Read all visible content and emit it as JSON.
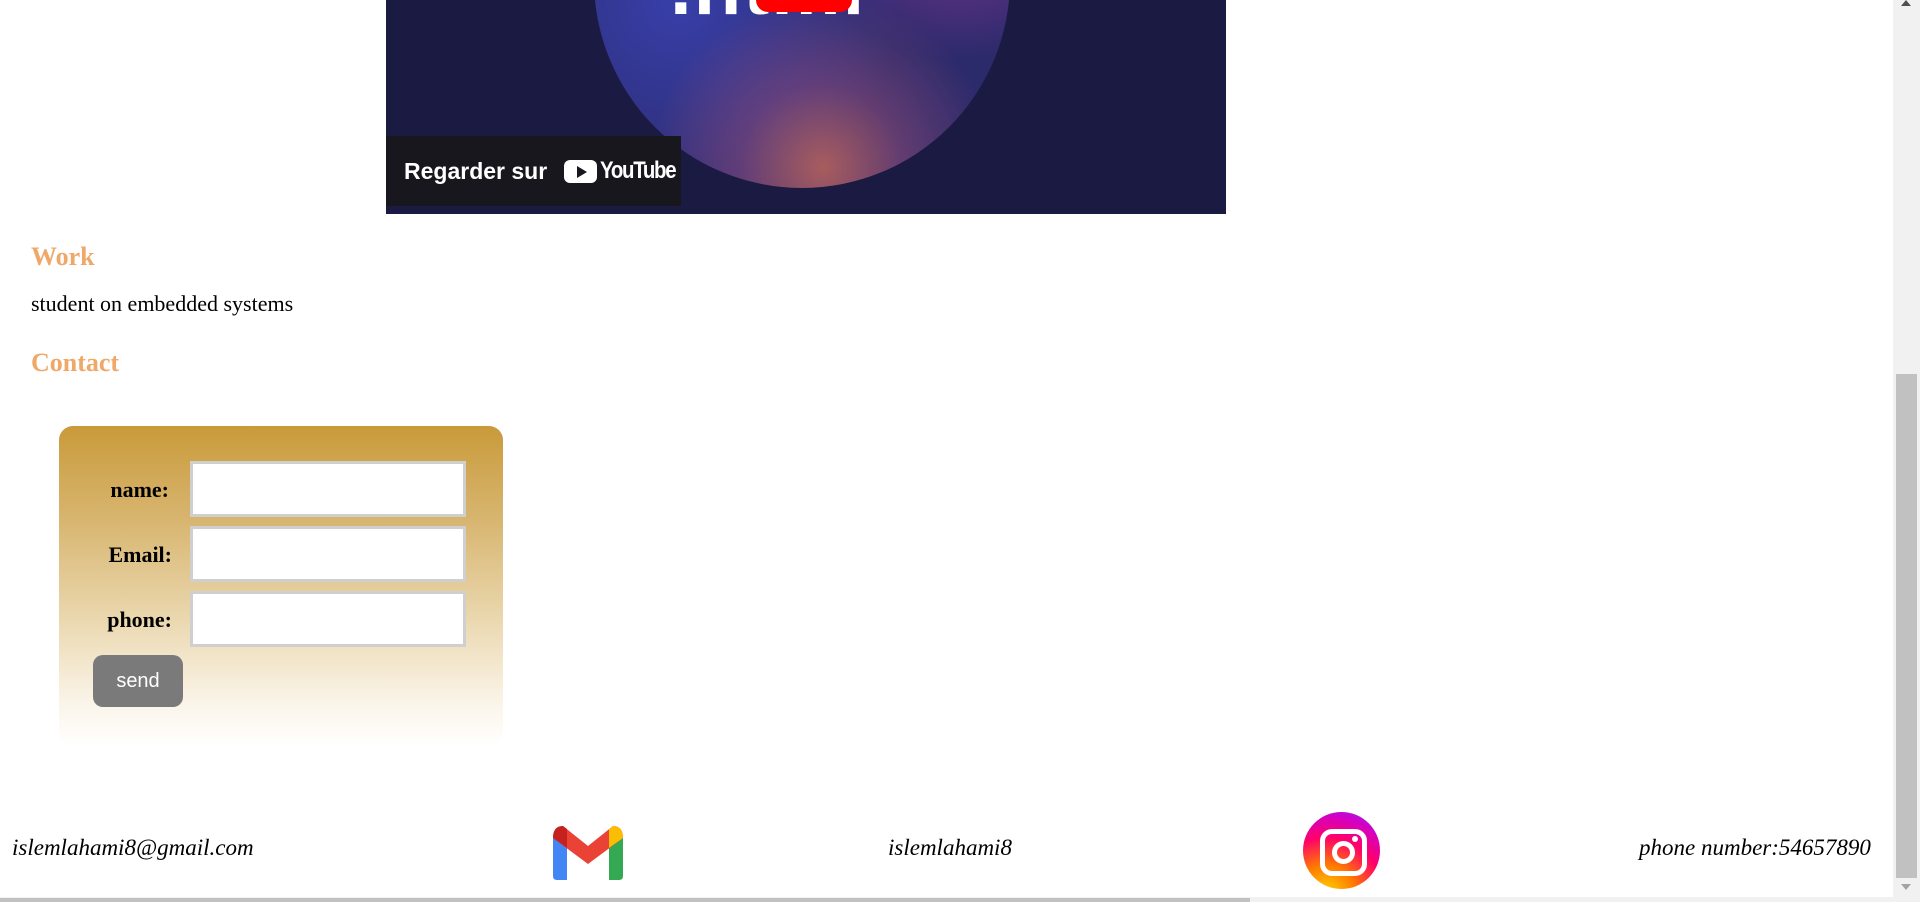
{
  "video": {
    "title_fragment": ".html",
    "watch_label": "Regarder sur",
    "youtube_wordmark": "YouTube",
    "play_icon": "youtube-play-icon"
  },
  "work": {
    "heading": "Work",
    "text": "student on embedded systems"
  },
  "contact": {
    "heading": "Contact",
    "form": {
      "name_label": "name:",
      "email_label": "Email:",
      "phone_label": "phone:",
      "name_value": "",
      "email_value": "",
      "phone_value": "",
      "send_label": "send"
    }
  },
  "footer": {
    "email": "islemlahami8@gmail.com",
    "gmail_icon": "gmail-icon",
    "instagram_handle": "islemlahami8",
    "instagram_icon": "instagram-icon",
    "phone": "phone number:54657890"
  },
  "colors": {
    "heading": "#f0a868",
    "form_gradient_top": "#c99a3a",
    "send_button": "#7a7a7a",
    "video_bg": "#1a1a42"
  }
}
